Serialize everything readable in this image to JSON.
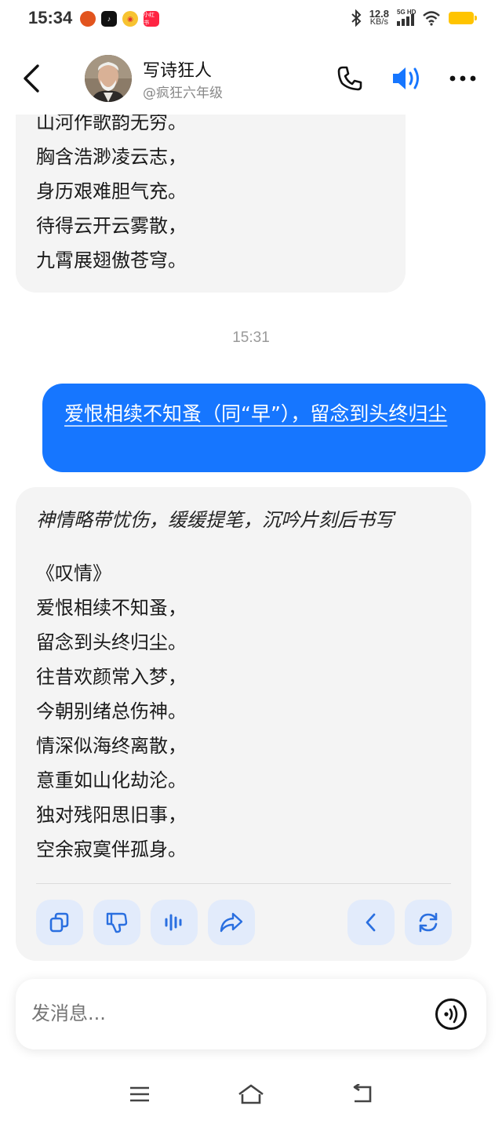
{
  "status_bar": {
    "time": "15:34",
    "net_speed_value": "12.8",
    "net_speed_unit": "KB/s",
    "signal_tag": "5G HD",
    "notification_app_label": "小红书"
  },
  "header": {
    "name": "写诗狂人",
    "handle": "@疯狂六年级"
  },
  "messages": {
    "prev_poem_lines": [
      "山河作歌韵无穷。",
      "胸含浩渺凌云志，",
      "身历艰难胆气充。",
      "待得云开云雾散，",
      "九霄展翅傲苍穹。"
    ],
    "timestamp": "15:31",
    "user_message": "爱恨相续不知蚤（同“早”），留念到头终归尘",
    "bot_note": "神情略带忧伤，缓缓提笔，沉吟片刻后书写",
    "poem_title": "《叹情》",
    "poem_lines": [
      "爱恨相续不知蚤，",
      "留念到头终归尘。",
      "往昔欢颜常入梦，",
      "今朝别绪总伤神。",
      "情深似海终离散，",
      "意重如山化劫沦。",
      "独对残阳思旧事，",
      "空余寂寞伴孤身。"
    ]
  },
  "composer": {
    "placeholder": "发消息..."
  },
  "icons": {
    "back": "chevron-left-icon",
    "phone": "phone-icon",
    "speaker": "speaker-icon",
    "more": "more-icon",
    "copy": "copy-icon",
    "dislike": "thumbs-down-icon",
    "read_aloud": "sound-wave-icon",
    "share": "share-icon",
    "prev": "chevron-left-icon",
    "regenerate": "refresh-icon",
    "voice": "voice-icon"
  },
  "colors": {
    "accent": "#1676ff",
    "user_bubble": "#1676ff",
    "bot_bubble": "#f4f4f4",
    "action_button_bg": "#e2ebfb",
    "action_icon": "#2a6fe0"
  }
}
